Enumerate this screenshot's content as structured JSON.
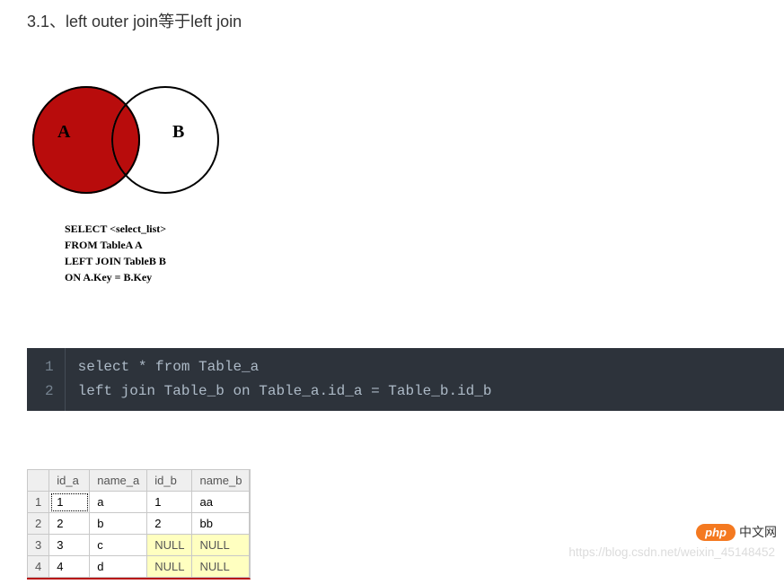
{
  "heading": "3.1、left outer join等于left join",
  "venn": {
    "label_a": "A",
    "label_b": "B",
    "sql_line1": "SELECT <select_list>",
    "sql_line2": "FROM TableA A",
    "sql_line3": "LEFT JOIN TableB B",
    "sql_line4": "ON A.Key = B.Key"
  },
  "code": {
    "line_numbers": [
      "1",
      "2"
    ],
    "line1": "select * from Table_a",
    "line2": "left join Table_b on Table_a.id_a = Table_b.id_b"
  },
  "table": {
    "headers": [
      "id_a",
      "name_a",
      "id_b",
      "name_b"
    ],
    "rows": [
      {
        "num": "1",
        "id_a": "1",
        "name_a": "a",
        "id_b": "1",
        "name_b": "aa",
        "id_b_null": false,
        "name_b_null": false
      },
      {
        "num": "2",
        "id_a": "2",
        "name_a": "b",
        "id_b": "2",
        "name_b": "bb",
        "id_b_null": false,
        "name_b_null": false
      },
      {
        "num": "3",
        "id_a": "3",
        "name_a": "c",
        "id_b": "NULL",
        "name_b": "NULL",
        "id_b_null": true,
        "name_b_null": true
      },
      {
        "num": "4",
        "id_a": "4",
        "name_a": "d",
        "id_b": "NULL",
        "name_b": "NULL",
        "id_b_null": true,
        "name_b_null": true
      }
    ]
  },
  "watermark": "https://blog.csdn.net/weixin_45148452",
  "logo": {
    "pill": "php",
    "text": "中文网"
  }
}
